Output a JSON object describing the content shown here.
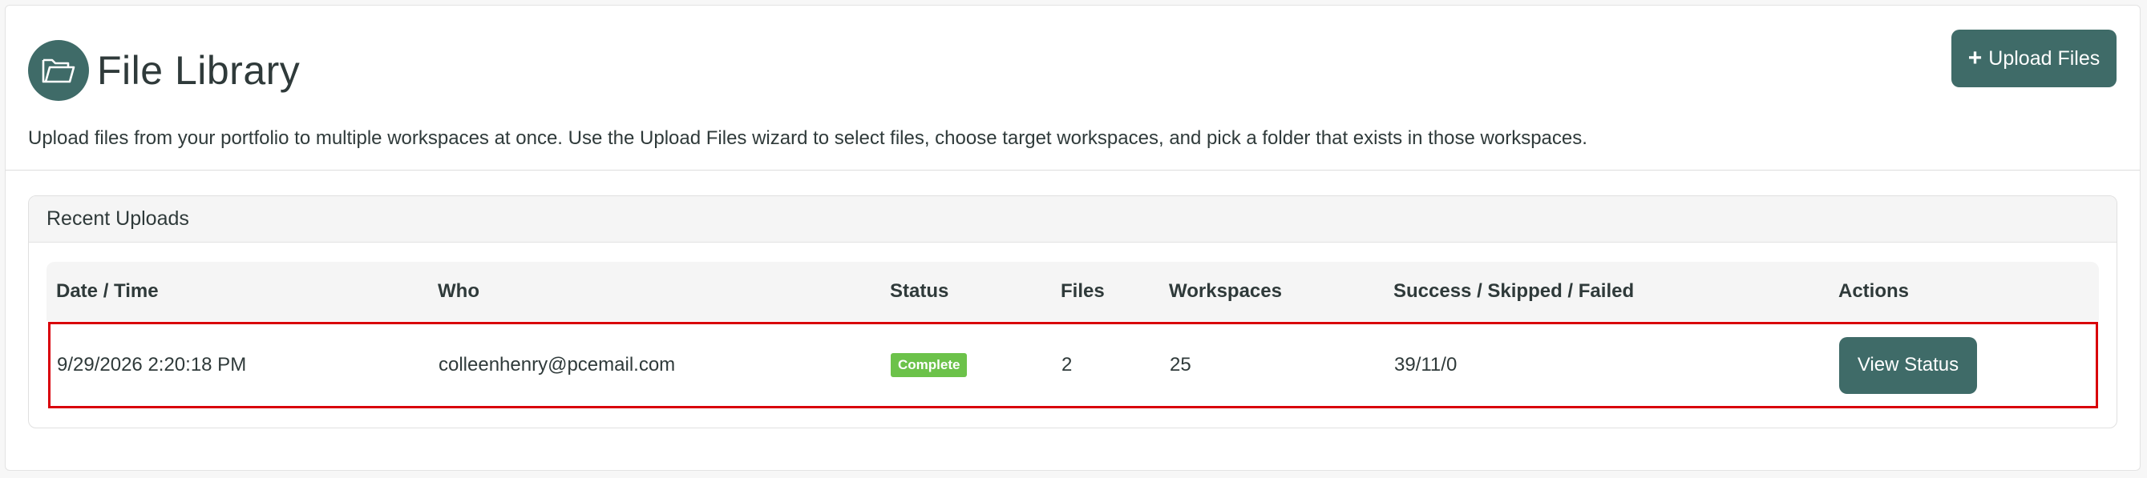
{
  "header": {
    "title": "File Library",
    "icon": "folder-open-icon",
    "upload_button_label": "Upload Files",
    "description": "Upload files from your portfolio to multiple workspaces at once. Use the Upload Files wizard to select files, choose target workspaces, and pick a folder that exists in those workspaces."
  },
  "recent_uploads": {
    "title": "Recent Uploads",
    "columns": [
      "Date / Time",
      "Who",
      "Status",
      "Files",
      "Workspaces",
      "Success / Skipped / Failed",
      "Actions"
    ],
    "rows": [
      {
        "datetime": "9/29/2026 2:20:18 PM",
        "who": "colleenhenry@pcemail.com",
        "status": "Complete",
        "files": "2",
        "workspaces": "25",
        "results": "39/11/0",
        "action_label": "View Status"
      }
    ]
  },
  "colors": {
    "accent": "#3f6b68",
    "status_complete": "#6cc24a",
    "highlight_border": "#d9000a"
  }
}
